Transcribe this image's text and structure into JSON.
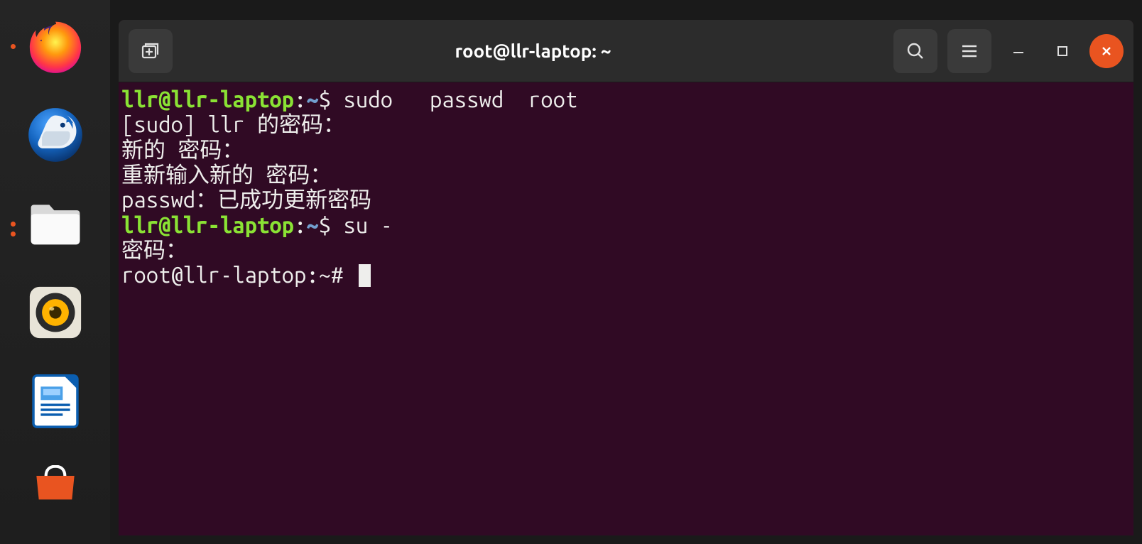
{
  "dock": {
    "items": [
      {
        "name": "firefox",
        "indicator": "single"
      },
      {
        "name": "thunderbird",
        "indicator": "none"
      },
      {
        "name": "files",
        "indicator": "double"
      },
      {
        "name": "rhythmbox",
        "indicator": "none"
      },
      {
        "name": "libreoffice-writer",
        "indicator": "none"
      },
      {
        "name": "software",
        "indicator": "none"
      }
    ]
  },
  "window": {
    "title": "root@llr-laptop: ~"
  },
  "terminal": {
    "lines": [
      {
        "type": "prompt",
        "user": "llr@llr-laptop",
        "sep": ":",
        "path": "~",
        "sym": "$",
        "cmd": " sudo   passwd  root"
      },
      {
        "type": "text",
        "text": "[sudo] llr 的密码："
      },
      {
        "type": "text",
        "text": "新的 密码："
      },
      {
        "type": "text",
        "text": "重新输入新的 密码："
      },
      {
        "type": "text",
        "text": "passwd：已成功更新密码"
      },
      {
        "type": "prompt",
        "user": "llr@llr-laptop",
        "sep": ":",
        "path": "~",
        "sym": "$",
        "cmd": " su -"
      },
      {
        "type": "text",
        "text": "密码："
      },
      {
        "type": "rootprompt",
        "text": "root@llr-laptop:~# ",
        "cursor": true
      }
    ]
  }
}
